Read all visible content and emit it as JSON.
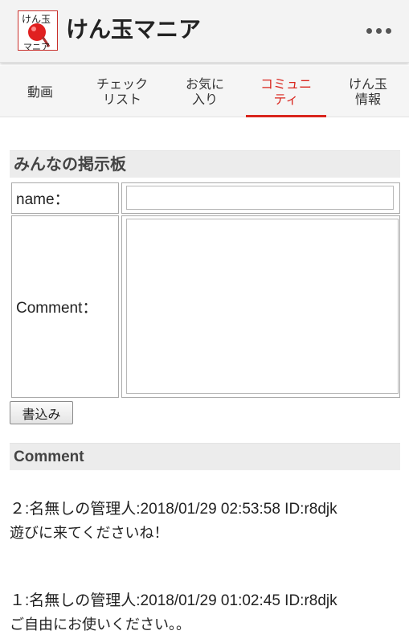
{
  "app": {
    "title": "けん玉マニア",
    "logo_text_top": "けん玉",
    "logo_text_bottom": "マニア",
    "menu_icon": "more-vertical-dots-icon"
  },
  "tabs": [
    {
      "label": "動画",
      "active": false
    },
    {
      "label": "チェック\nリスト",
      "active": false
    },
    {
      "label": "お気に\n入り",
      "active": false
    },
    {
      "label": "コミュニ\nティ",
      "active": true
    },
    {
      "label": "けん玉\n情報",
      "active": false
    }
  ],
  "board": {
    "heading": "みんなの掲示板",
    "name_label": "name：",
    "name_value": "",
    "comment_label": "Comment：",
    "comment_value": "",
    "submit_label": "書込み"
  },
  "comments": {
    "heading": "Comment",
    "posts": [
      {
        "meta": "２:名無しの管理人:2018/01/29 02:53:58 ID:r8djk",
        "body": "遊びに来てくださいね！"
      },
      {
        "meta": "１:名無しの管理人:2018/01/29 01:02:45 ID:r8djk",
        "body": "ご自由にお使いください。。"
      }
    ]
  },
  "colors": {
    "accent": "#d9251d",
    "appbar_bg": "#f3f3f3",
    "section_bg": "#ececec"
  }
}
